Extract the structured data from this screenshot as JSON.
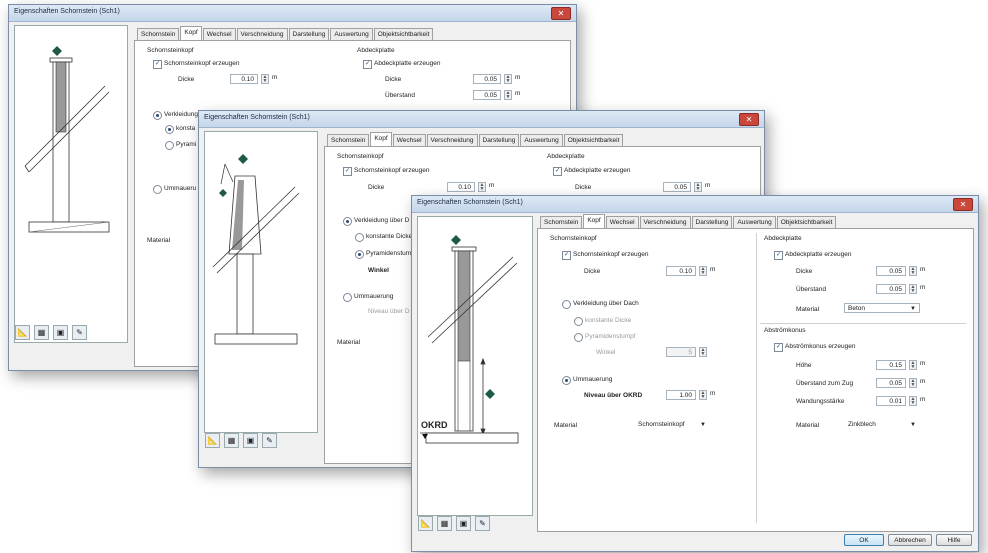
{
  "window_title": "Eigenschaften Schornstein (Sch1)",
  "close_label": "✕",
  "tabs": [
    "Schornstein",
    "Kopf",
    "Wechsel",
    "Verschneidung",
    "Darstellung",
    "Auswertung",
    "Objektsichtbarkeit"
  ],
  "active_tab": "Kopf",
  "kopf": {
    "section": "Schornsteinkopf",
    "create_label": "Schornsteinkopf erzeugen",
    "create_checked": true,
    "thickness_label": "Dicke",
    "thickness_value": "0.10",
    "unit": "m",
    "cladding_label": "Verkleidung über Dach",
    "cladding_short": "Verkleidung über D",
    "cladding_trunc": "Verkleidung",
    "const_thickness_label": "konstante Dicke",
    "const_trunc": "konsta",
    "pyramid_label": "Pyramidenstumpf",
    "pyramid_trunc": "Pyramidenstump",
    "pyramid_trunc2": "Pyrami",
    "angle_label": "Winkel",
    "angle_value": "5",
    "masonry_label": "Ummauerung",
    "masonry_trunc": "Ummaueru",
    "level_label": "Niveau über OKRD",
    "level_trunc": "Niveau über D",
    "level_value": "1.00",
    "material_label": "Material",
    "material_value": "Schornsteinkopf"
  },
  "cover": {
    "section": "Abdeckplatte",
    "create_label": "Abdeckplatte erzeugen",
    "create_checked": true,
    "thickness_label": "Dicke",
    "thickness_value": "0.05",
    "overhang_label": "Überstand",
    "overhang_value": "0.05",
    "material_label": "Material",
    "material_value": "Beton"
  },
  "cone": {
    "section": "Abströmkonus",
    "create_label": "Abströmkonus erzeugen",
    "create_checked": true,
    "height_label": "Höhe",
    "height_value": "0.15",
    "overhang_label": "Überstand zum Zug",
    "overhang_value": "0.05",
    "wall_label": "Wandungsstärke",
    "wall_value": "0.01",
    "material_label": "Material",
    "material_value": "Zinkblech"
  },
  "diagram": {
    "okrd_label": "OKRD"
  },
  "buttons": {
    "ok": "OK",
    "cancel": "Abbrechen",
    "help": "Hilfe"
  },
  "icons": [
    "measure-icon",
    "layers-icon",
    "view-icon",
    "paint-icon"
  ]
}
